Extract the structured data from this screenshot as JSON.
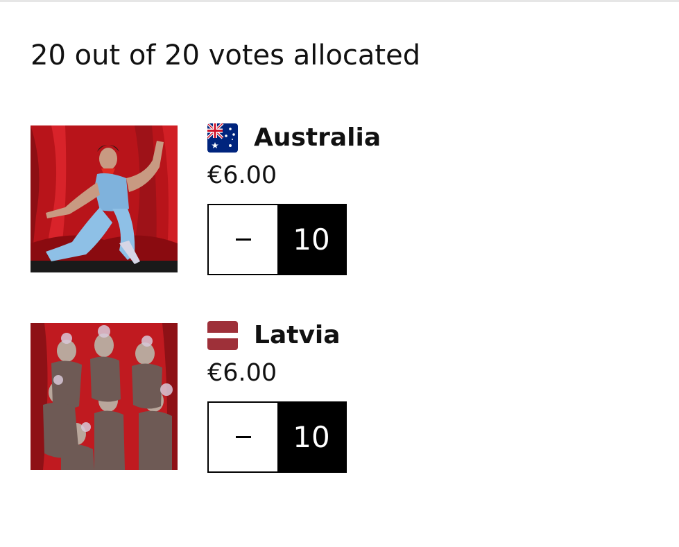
{
  "summary": {
    "text": "20 out of 20 votes allocated"
  },
  "entries": [
    {
      "country": "Australia",
      "price": "€6.00",
      "votes": "10",
      "flag_icon": "australia-flag-icon",
      "decrement_icon": "minus-icon"
    },
    {
      "country": "Latvia",
      "price": "€6.00",
      "votes": "10",
      "flag_icon": "latvia-flag-icon",
      "decrement_icon": "minus-icon"
    }
  ],
  "colors": {
    "text": "#111111",
    "stepper_fill": "#000000",
    "stepper_text": "#ffffff",
    "latvia_red": "#9e3039",
    "australia_blue": "#00247d",
    "stage_red": "#c4161c"
  }
}
